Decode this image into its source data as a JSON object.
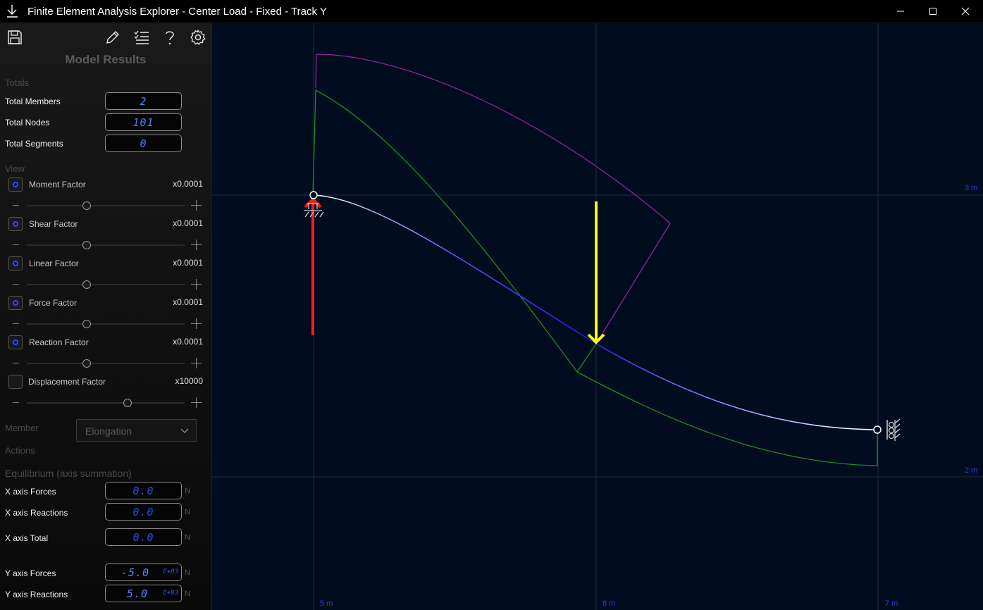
{
  "window": {
    "title": "Finite Element Analysis Explorer - Center Load - Fixed - Track Y"
  },
  "panel": {
    "title": "Model Results",
    "totals_label": "Totals",
    "totals": [
      {
        "label": "Total Members",
        "value": "2"
      },
      {
        "label": "Total Nodes",
        "value": "101"
      },
      {
        "label": "Total Segments",
        "value": "0"
      }
    ],
    "view_label": "View",
    "factors": [
      {
        "label": "Moment Factor",
        "multiplier": "x0.0001",
        "checked": true,
        "slider": 0.38
      },
      {
        "label": "Shear Factor",
        "multiplier": "x0.0001",
        "checked": true,
        "slider": 0.38
      },
      {
        "label": "Linear Factor",
        "multiplier": "x0.0001",
        "checked": true,
        "slider": 0.38
      },
      {
        "label": "Force Factor",
        "multiplier": "x0.0001",
        "checked": true,
        "slider": 0.38
      },
      {
        "label": "Reaction Factor",
        "multiplier": "x0.0001",
        "checked": true,
        "slider": 0.38
      },
      {
        "label": "Displacement Factor",
        "multiplier": "x10000",
        "checked": false,
        "slider": 0.64
      }
    ],
    "member_label": "Member",
    "member_dropdown": "Elongation",
    "actions_label": "Actions",
    "equilibrium_label": "Equilibrium (axis summation)",
    "equilibrium": [
      {
        "label": "X axis Forces",
        "value": "0.0",
        "exp": "",
        "unit": "N"
      },
      {
        "label": "X axis Reactions",
        "value": "0.0",
        "exp": "",
        "unit": "N"
      },
      {
        "label": "X axis Total",
        "value": "0.0",
        "exp": "",
        "unit": "N"
      },
      {
        "label": "Y axis Forces",
        "value": "-5.0",
        "exp": "E+03",
        "unit": "N"
      },
      {
        "label": "Y axis Reactions",
        "value": "5.0",
        "exp": "E+03",
        "unit": "N"
      }
    ]
  },
  "canvas": {
    "x_labels": [
      "5 m",
      "6 m",
      "7 m"
    ],
    "y_labels": [
      "3 m",
      "2 m"
    ],
    "colors": {
      "background": "#010d1f",
      "grid": "#1d2a3a",
      "axis_text": "#2a3fd0",
      "moment": "#a020a0",
      "shear": "#1e8c1e",
      "reaction": "#ff1a1a",
      "load": "#ffff00"
    }
  },
  "icons": [
    "download-icon",
    "save-icon",
    "edit-pencil-icon",
    "checklist-icon",
    "help-icon",
    "settings-gear-icon",
    "minimize-icon",
    "maximize-icon",
    "close-icon"
  ]
}
